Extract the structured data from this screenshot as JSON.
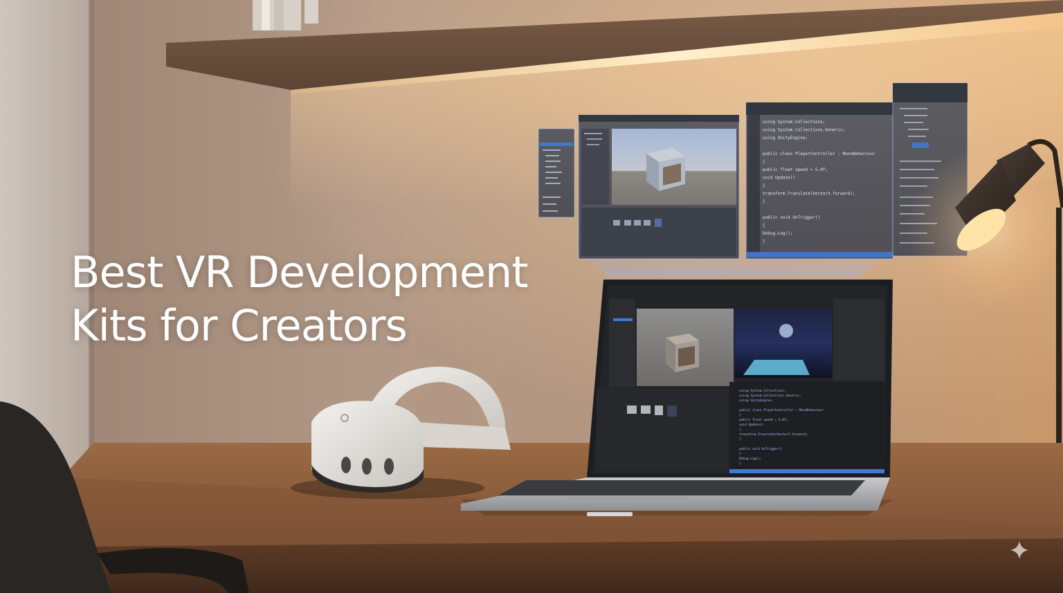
{
  "headline": {
    "line1": "Best VR Development",
    "line2": "Kits for Creators"
  },
  "code_lines": [
    "using System.Collections;",
    "using System.Collections.Generic;",
    "using UnityEngine;",
    "",
    "public class PlayerController : MonoBehaviour",
    "{",
    "    public float speed = 5.0f;",
    "    void Update()",
    "    {",
    "        transform.Translate(Vector3.forward);",
    "    }",
    "",
    "    public void OnTrigger()",
    "    {",
    "        Debug.Log();",
    "    }",
    "}"
  ],
  "icons": {
    "watermark": "sparkle-icon"
  },
  "colors": {
    "wall": "#b09684",
    "led": "#ffcf8a",
    "desk": "#8a5a36",
    "holo": "#7ea2d8",
    "editor_dark": "#26282c",
    "headline": "#ffffff"
  }
}
